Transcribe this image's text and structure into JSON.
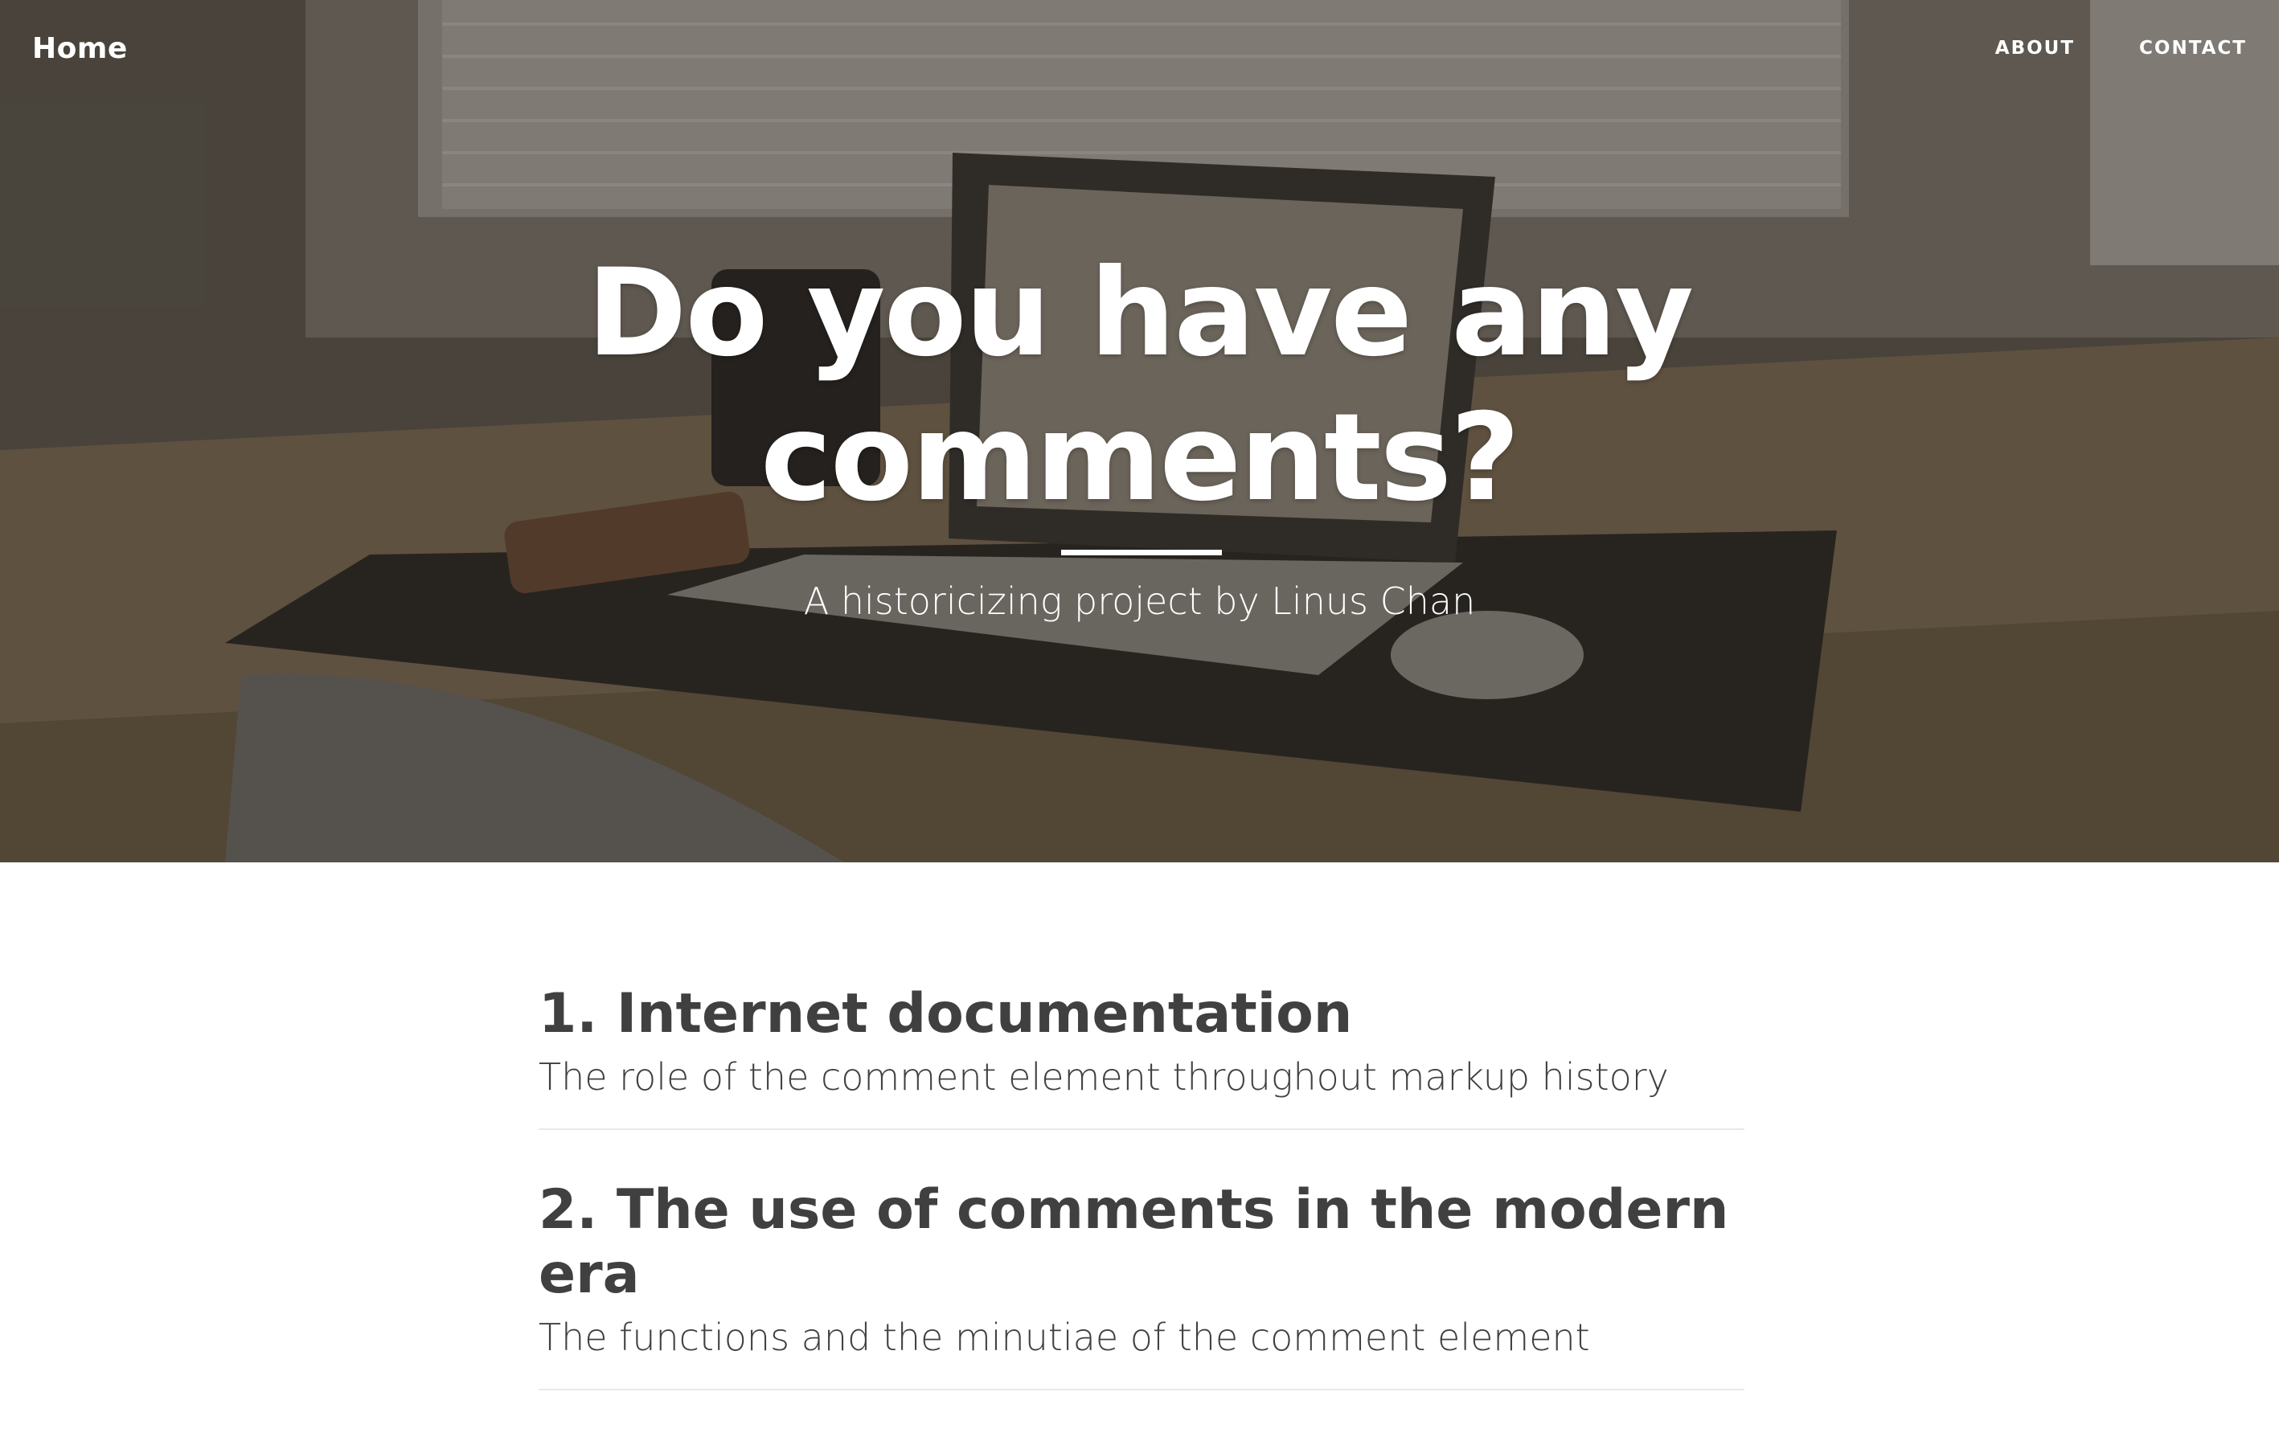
{
  "nav": {
    "brand": "Home",
    "links": [
      "ABOUT",
      "CONTACT"
    ]
  },
  "hero": {
    "heading_lines": [
      "Do you have any",
      "comments?"
    ],
    "subheading": "A historicizing project by Linus Chan",
    "background_image": "desk-laptop-photo"
  },
  "posts": [
    {
      "title": "1. Internet documentation",
      "subtitle": "The role of the comment element throughout markup history"
    },
    {
      "title": "2. The use of comments in the modern era",
      "subtitle": "The functions and the minutiae of the comment element"
    }
  ],
  "colors": {
    "text_dark": "#404040",
    "divider": "#e9e9e9",
    "hero_text": "#ffffff"
  }
}
